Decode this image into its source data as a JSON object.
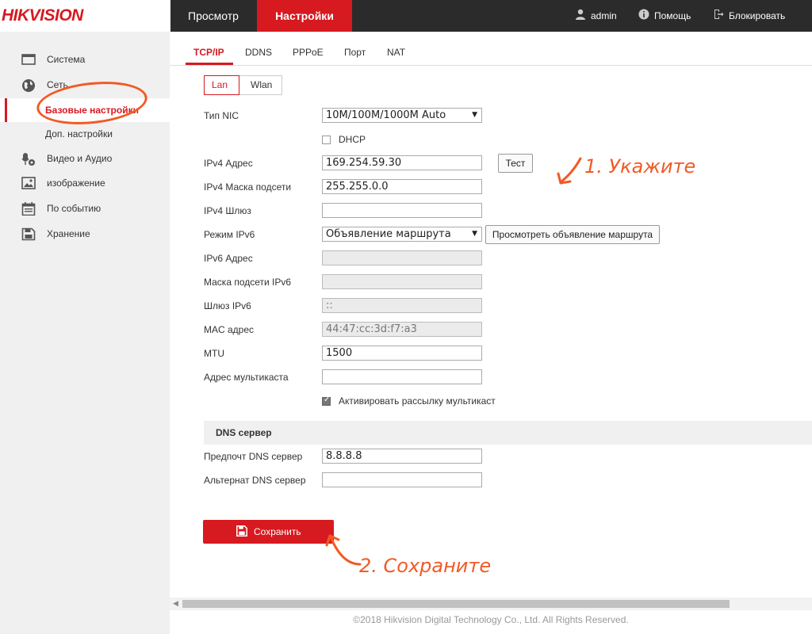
{
  "header": {
    "logo": "HIKVISION",
    "tabs": [
      {
        "label": "Просмотр"
      },
      {
        "label": "Настройки"
      }
    ],
    "user": "admin",
    "help": "Помощь",
    "lock": "Блокировать"
  },
  "sidebar": {
    "items": [
      {
        "label": "Система",
        "icon": "monitor-icon"
      },
      {
        "label": "Сеть",
        "icon": "globe-icon"
      },
      {
        "label": "Базовые настройки"
      },
      {
        "label": "Доп. настройки"
      },
      {
        "label": "Видео и Аудио",
        "icon": "microphone-camera-icon"
      },
      {
        "label": "изображение",
        "icon": "image-icon"
      },
      {
        "label": "По событию",
        "icon": "calendar-icon"
      },
      {
        "label": "Хранение",
        "icon": "save-icon"
      }
    ]
  },
  "subtabs": [
    "TCP/IP",
    "DDNS",
    "PPPoE",
    "Порт",
    "NAT"
  ],
  "iface_tabs": [
    "Lan",
    "Wlan"
  ],
  "form": {
    "nic_type": {
      "label": "Тип NIC",
      "value": "10M/100M/1000M Auto"
    },
    "dhcp": {
      "label": "DHCP",
      "checked": false
    },
    "ipv4_addr": {
      "label": "IPv4 Адрес",
      "value": "169.254.59.30"
    },
    "test_button": "Тест",
    "ipv4_mask": {
      "label": "IPv4 Маска подсети",
      "value": "255.255.0.0"
    },
    "ipv4_gw": {
      "label": "IPv4 Шлюз",
      "value": ""
    },
    "ipv6_mode": {
      "label": "Режим IPv6",
      "value": "Объявление маршрута"
    },
    "route_adv_button": "Просмотреть объявление маршрута",
    "ipv6_addr": {
      "label": "IPv6 Адрес",
      "value": ""
    },
    "ipv6_mask": {
      "label": "Маска подсети IPv6",
      "value": ""
    },
    "ipv6_gw": {
      "label": "Шлюз IPv6",
      "value": "::"
    },
    "mac": {
      "label": "MAC адрес",
      "value": "44:47:cc:3d:f7:a3"
    },
    "mtu": {
      "label": "MTU",
      "value": "1500"
    },
    "multicast": {
      "label": "Адрес мультикаста",
      "value": ""
    },
    "multicast_enable": {
      "label": "Активировать рассылку мультикаст",
      "checked": true
    }
  },
  "dns": {
    "title": "DNS сервер",
    "preferred": {
      "label": "Предпочт DNS сервер",
      "value": "8.8.8.8"
    },
    "alternate": {
      "label": "Альтернат DNS сервер",
      "value": ""
    }
  },
  "save_button": "Сохранить",
  "footer": "©2018 Hikvision Digital Technology Co., Ltd. All Rights Reserved.",
  "annotations": {
    "step1": "1. Укажите",
    "step2": "2. Сохраните"
  },
  "colors": {
    "brand": "#d71920",
    "annotation": "#f15a24",
    "header_bg": "#2b2b2b"
  }
}
